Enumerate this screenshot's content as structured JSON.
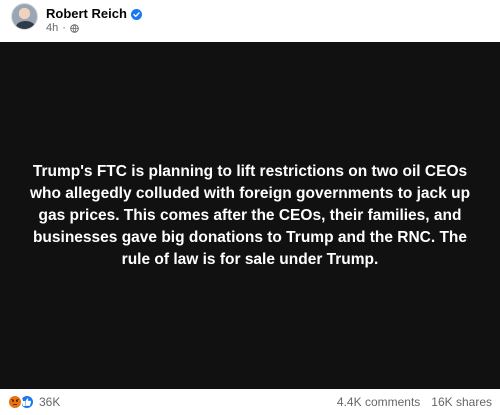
{
  "post": {
    "author": "Robert Reich",
    "time": "4h",
    "separator": "·",
    "body": "Trump's FTC is planning to lift restrictions on two oil CEOs who allegedly colluded with foreign governments to jack up gas prices. This comes after the CEOs, their families, and businesses gave big donations to Trump and the RNC. The rule of law is for sale under Trump."
  },
  "engagement": {
    "reaction_count": "36K",
    "comments": "4.4K comments",
    "shares": "16K shares"
  },
  "icons": [
    "verified-badge-icon",
    "globe-icon",
    "angry-reaction-icon",
    "like-reaction-icon"
  ],
  "colors": {
    "media_background": "#111111",
    "post_text": "#ffffff",
    "verified": "#1877f2",
    "angry_reaction": "#e9710f",
    "like_reaction": "#1877f2",
    "secondary_text": "#65676b"
  }
}
